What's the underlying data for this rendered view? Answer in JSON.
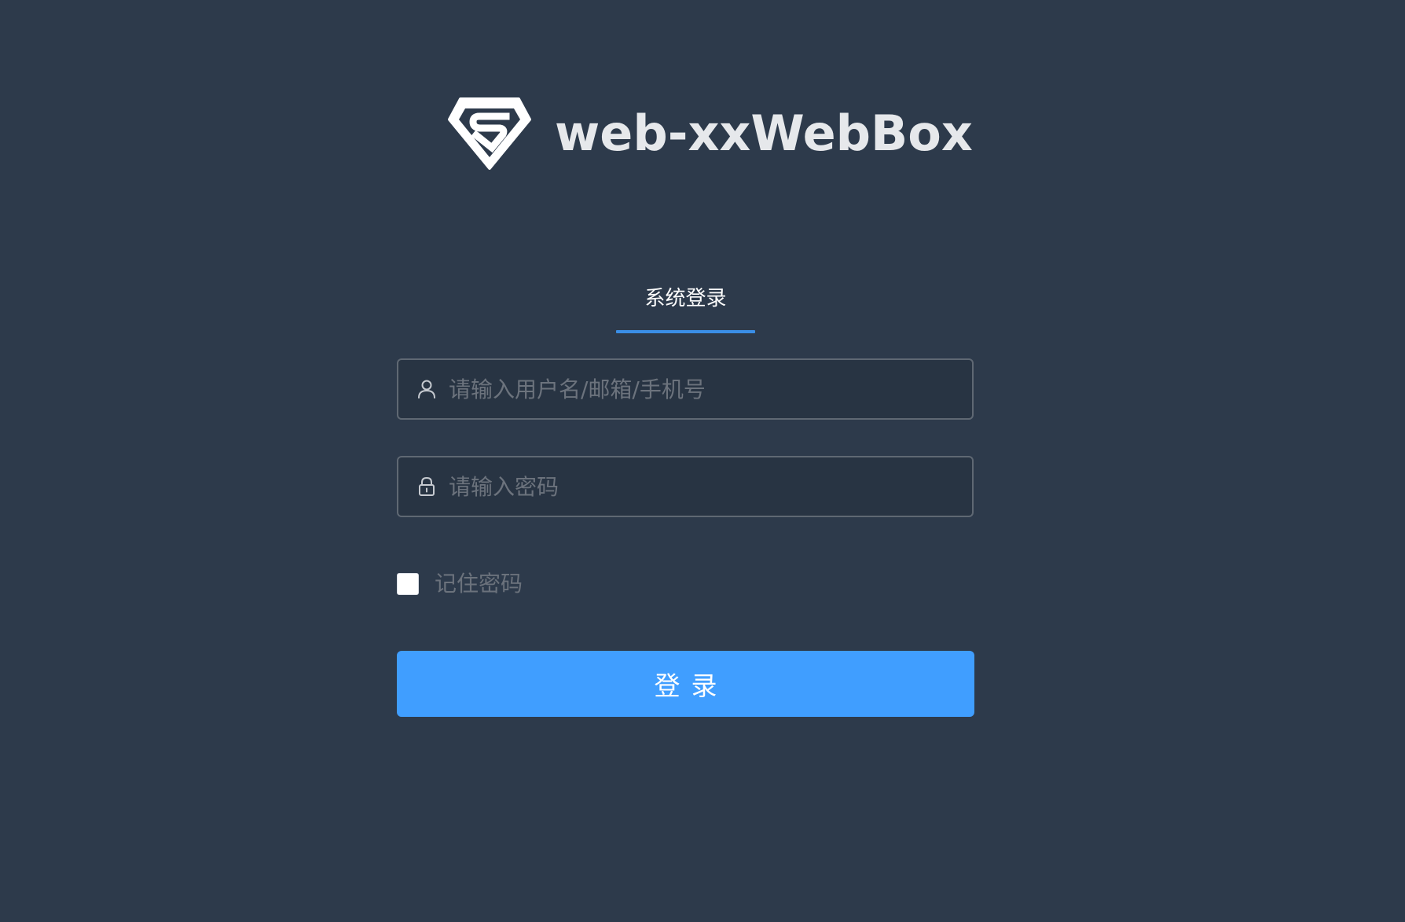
{
  "brand": {
    "title": "web-xxWebBox",
    "logo_icon": "shield-s-logo-icon"
  },
  "tabs": [
    {
      "label": "系统登录",
      "active": true
    }
  ],
  "form": {
    "username": {
      "placeholder": "请输入用户名/邮箱/手机号",
      "value": "",
      "icon": "user-icon"
    },
    "password": {
      "placeholder": "请输入密码",
      "value": "",
      "icon": "lock-icon"
    },
    "remember": {
      "label": "记住密码",
      "checked": false
    },
    "submit_label": "登录"
  },
  "colors": {
    "background": "#2d3a4b",
    "accent": "#409eff",
    "tab_underline": "#3a8ee6",
    "input_background": "#283443",
    "input_border": "#5f6873",
    "title_text": "#e6e8eb",
    "muted_text": "#6b727c"
  }
}
